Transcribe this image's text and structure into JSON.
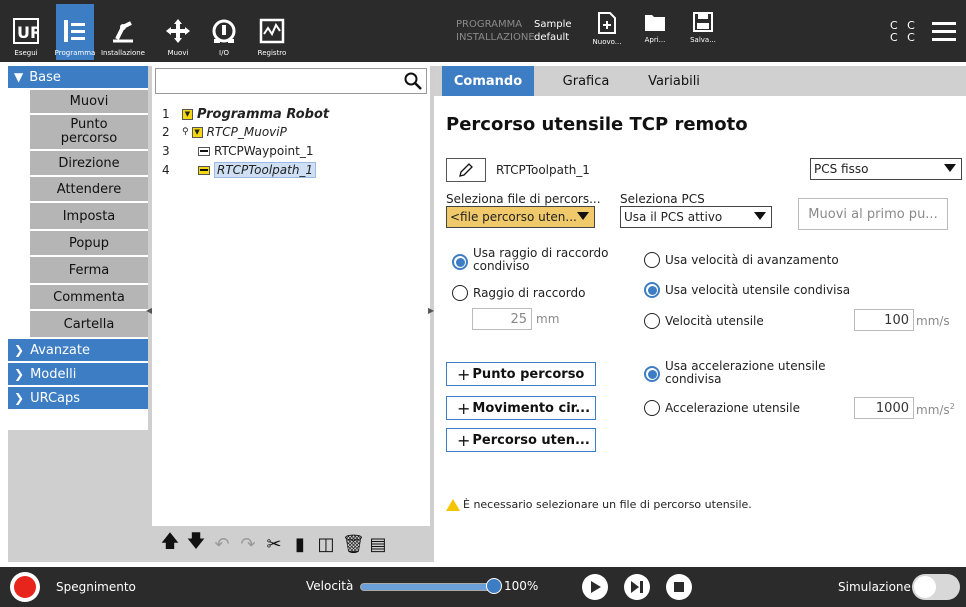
{
  "topbar": {
    "nav": [
      {
        "label": "Esegui",
        "icon": "ur-logo-icon"
      },
      {
        "label": "Programma",
        "icon": "program-icon"
      },
      {
        "label": "Installazione",
        "icon": "installation-icon"
      },
      {
        "label": "Muovi",
        "icon": "move-icon"
      },
      {
        "label": "I/O",
        "icon": "io-icon"
      },
      {
        "label": "Registro",
        "icon": "log-icon"
      }
    ],
    "programma_key": "PROGRAMMA",
    "programma_value": "Sample",
    "installazione_key": "INSTALLAZIONE",
    "installazione_value": "default",
    "nuovo": "Nuovo...",
    "apri": "Apri...",
    "salva": "Salva...",
    "cc1": "C C",
    "cc2": "C C"
  },
  "sidebar": {
    "base": "Base",
    "items": [
      "Muovi",
      "Punto percorso",
      "Direzione",
      "Attendere",
      "Imposta",
      "Popup",
      "Ferma",
      "Commenta",
      "Cartella"
    ],
    "avanzate": "Avanzate",
    "modelli": "Modelli",
    "urcaps": "URCaps"
  },
  "tree": {
    "search_placeholder": "",
    "rows": [
      {
        "num": "1",
        "label": "Programma Robot"
      },
      {
        "num": "2",
        "label": "RTCP_MuoviP"
      },
      {
        "num": "3",
        "label": "RTCPWaypoint_1"
      },
      {
        "num": "4",
        "label": "RTCPToolpath_1"
      }
    ]
  },
  "tabs": [
    "Comando",
    "Grafica",
    "Variabili"
  ],
  "panel": {
    "title": "Percorso utensile TCP remoto",
    "node_name": "RTCPToolpath_1",
    "pcs_mode": "PCS fisso",
    "file_label": "Seleziona file di percors...",
    "file_value": "<file percorso uten...",
    "pcs_label": "Seleziona PCS",
    "pcs_value": "Usa il PCS attivo",
    "move_first": "Muovi al primo pu...",
    "radius_shared": "Usa raggio di raccordo condiviso",
    "radius": "Raggio di raccordo",
    "radius_value": "25",
    "radius_unit": "mm",
    "speed_feed": "Usa velocità di avanzamento",
    "speed_shared": "Usa velocità utensile condivisa",
    "speed_tool": "Velocità utensile",
    "speed_value": "100",
    "speed_unit": "mm/s",
    "acc_shared": "Usa accelerazione utensile condivisa",
    "acc_tool": "Accelerazione utensile",
    "acc_value": "1000",
    "acc_unit": "mm/s",
    "acc_exp": "2",
    "add_waypoint": "Punto percorso",
    "add_circle": "Movimento cir...",
    "add_toolpath": "Percorso uten...",
    "warning": "È necessario selezionare un file di percorso utensile."
  },
  "bottombar": {
    "power": "Spegnimento",
    "speed_label": "Velocità",
    "speed_value": "100%",
    "speed_fraction": 1.0,
    "simulation": "Simulazione"
  },
  "colors": {
    "accent": "#3d7dc4",
    "topbar": "#2b2b2b",
    "power": "#e8251d",
    "file_field": "#f0c96a"
  }
}
